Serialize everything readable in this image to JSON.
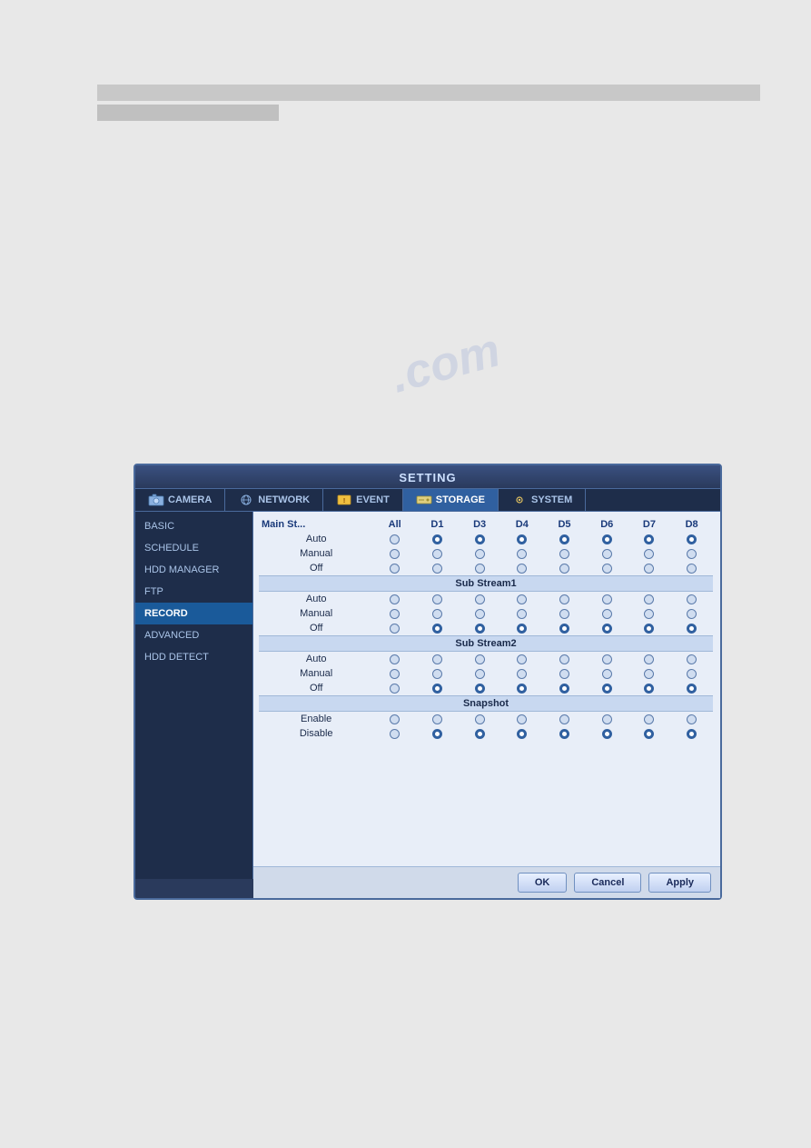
{
  "topBars": {
    "visible": true
  },
  "watermark": ".com",
  "dialog": {
    "title": "SETTING",
    "tabs": [
      {
        "id": "camera",
        "label": "CAMERA",
        "icon": "camera-icon",
        "active": false
      },
      {
        "id": "network",
        "label": "NETWORK",
        "icon": "network-icon",
        "active": false
      },
      {
        "id": "event",
        "label": "EVENT",
        "icon": "event-icon",
        "active": false
      },
      {
        "id": "storage",
        "label": "STORAGE",
        "icon": "storage-icon",
        "active": true
      },
      {
        "id": "system",
        "label": "SYSTEM",
        "icon": "system-icon",
        "active": false
      }
    ],
    "sidebar": {
      "items": [
        {
          "id": "basic",
          "label": "BASIC",
          "active": false
        },
        {
          "id": "schedule",
          "label": "SCHEDULE",
          "active": false
        },
        {
          "id": "hdd-manager",
          "label": "HDD MANAGER",
          "active": false
        },
        {
          "id": "ftp",
          "label": "FTP",
          "active": false
        },
        {
          "id": "record",
          "label": "RECORD",
          "active": true
        },
        {
          "id": "advanced",
          "label": "ADVANCED",
          "active": false
        },
        {
          "id": "hdd-detect",
          "label": "HDD DETECT",
          "active": false
        }
      ]
    },
    "table": {
      "columns": [
        "Main St...",
        "All",
        "D1",
        "D3",
        "D4",
        "D5",
        "D6",
        "D7",
        "D8"
      ],
      "sections": [
        {
          "id": "main-stream",
          "header": "",
          "rows": [
            {
              "label": "Auto",
              "values": [
                false,
                true,
                true,
                true,
                true,
                true,
                true,
                true
              ]
            },
            {
              "label": "Manual",
              "values": [
                false,
                false,
                false,
                false,
                false,
                false,
                false,
                false
              ]
            },
            {
              "label": "Off",
              "values": [
                false,
                false,
                false,
                false,
                false,
                false,
                false,
                false
              ]
            }
          ]
        },
        {
          "id": "sub-stream1",
          "header": "Sub Stream1",
          "rows": [
            {
              "label": "Auto",
              "values": [
                false,
                false,
                false,
                false,
                false,
                false,
                false,
                false
              ]
            },
            {
              "label": "Manual",
              "values": [
                false,
                false,
                false,
                false,
                false,
                false,
                false,
                false
              ]
            },
            {
              "label": "Off",
              "values": [
                false,
                true,
                true,
                true,
                true,
                true,
                true,
                true
              ]
            }
          ]
        },
        {
          "id": "sub-stream2",
          "header": "Sub Stream2",
          "rows": [
            {
              "label": "Auto",
              "values": [
                false,
                false,
                false,
                false,
                false,
                false,
                false,
                false
              ]
            },
            {
              "label": "Manual",
              "values": [
                false,
                false,
                false,
                false,
                false,
                false,
                false,
                false
              ]
            },
            {
              "label": "Off",
              "values": [
                false,
                true,
                true,
                true,
                true,
                true,
                true,
                true
              ]
            }
          ]
        },
        {
          "id": "snapshot",
          "header": "Snapshot",
          "rows": [
            {
              "label": "Enable",
              "values": [
                false,
                false,
                false,
                false,
                false,
                false,
                false,
                false
              ]
            },
            {
              "label": "Disable",
              "values": [
                false,
                true,
                true,
                true,
                true,
                true,
                true,
                true
              ]
            }
          ]
        }
      ]
    },
    "buttons": {
      "ok": "OK",
      "cancel": "Cancel",
      "apply": "Apply"
    }
  }
}
